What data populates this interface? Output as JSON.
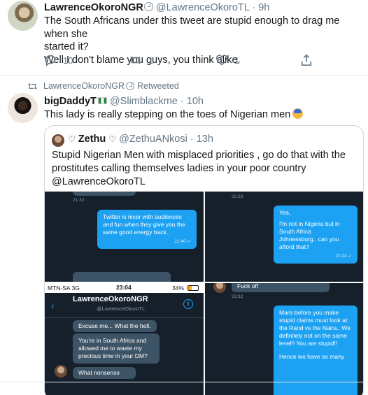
{
  "tweet1": {
    "name": "LawrenceOkoroNGR",
    "handle": "@LawrenceOkoroTL",
    "dot": "·",
    "time": "9h",
    "text_line1": "The South Africans under this tweet are stupid enough to drag me when she",
    "text_line2": "started it?",
    "text_line3": "Well I don't blame you guys, you think alike.",
    "reply_count": "10",
    "retweet_count": "1",
    "like_count": "1"
  },
  "tweet2": {
    "retweeted_by": "LawrenceOkoroNGR",
    "retweeted_label": "Retweeted",
    "name": "bigDaddyT",
    "handle": "@Slimblackme",
    "dot": "·",
    "time": "10h",
    "text": "This lady is really stepping on the toes of Nigerian men",
    "quote": {
      "name": "Zethu",
      "handle": "@ZethuANkosi",
      "dot": "·",
      "time": "13h",
      "text_line1": "Stupid Nigerian Men with misplaced priorities , go do that with the",
      "text_line2": "prostitutes calling themselves ladies in your poor country",
      "text_line3": "@LawrenceOkoroTL",
      "screenshots": {
        "c1": {
          "time_top": "21:33",
          "bubble": "Twitter is nicer with audiences and fun when they give you the same good energy back.",
          "bubble_time": "21:40 ✓"
        },
        "c2": {
          "time_top": "22:23",
          "bubble_line1": "Yes,",
          "bubble_line2": "I'm not in Nigeria but in South Africa",
          "bubble_line3": "Johnessburg.. can you afford that?",
          "bubble_time": "22:24 ✓"
        },
        "c3": {
          "carrier": "MTN-SA  3G",
          "clock": "23:04",
          "battery": "34%",
          "chat_name": "LawrenceOkoroNGR",
          "chat_handle": "@LawrenceOkoroTL",
          "b1": "Excuse me... What the hell.",
          "b2": "You're in South Africa and allowed me to waste my precious time in your DM?",
          "b3": "What nonsense"
        },
        "c4": {
          "top_bubble": "Fuck off",
          "time_top": "22:32",
          "bubble": "Mara before you make stupid claims must look at the Rand vs the Naira.. We definitely not on the same level!! You are stupid!!",
          "bubble_last": "Hence we have so many"
        }
      }
    }
  },
  "colors": {
    "accent": "#1da1f2",
    "text_secondary": "#657786",
    "dark_bg": "#15202b"
  }
}
